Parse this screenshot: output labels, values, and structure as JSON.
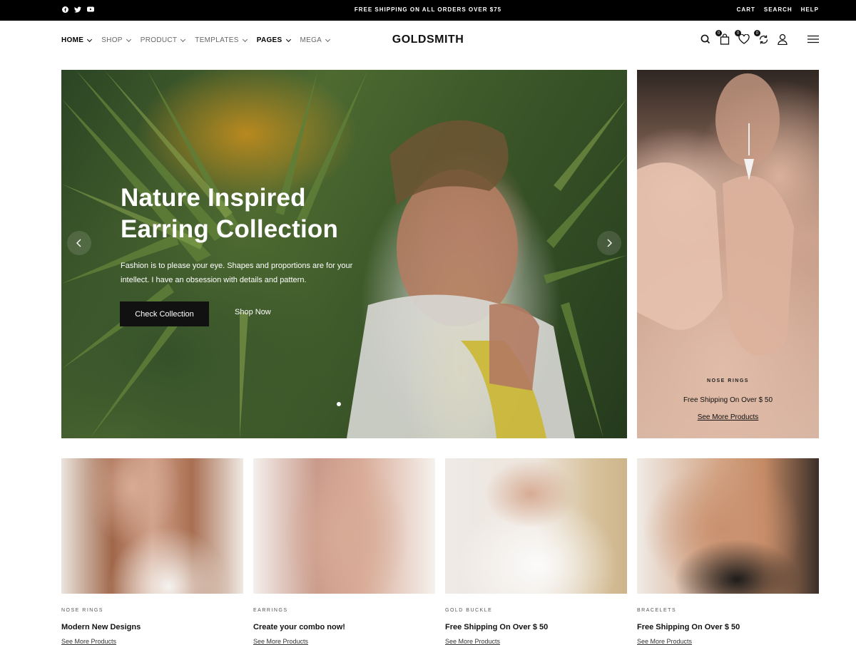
{
  "topbar": {
    "promo": "FREE SHIPPING ON ALL ORDERS OVER $75",
    "links": [
      "CART",
      "SEARCH",
      "HELP"
    ],
    "social_icons": [
      "facebook-icon",
      "twitter-icon",
      "youtube-icon"
    ]
  },
  "header": {
    "logo": "GOLDSMITH",
    "nav": [
      {
        "label": "HOME",
        "active": true
      },
      {
        "label": "SHOP",
        "active": false
      },
      {
        "label": "PRODUCT",
        "active": false
      },
      {
        "label": "TEMPLATES",
        "active": false
      },
      {
        "label": "PAGES",
        "active": true
      },
      {
        "label": "MEGA",
        "active": false
      }
    ],
    "badges": {
      "cart": "0",
      "wishlist": "0",
      "compare": "0"
    },
    "icons": [
      "search-icon",
      "bag-icon",
      "heart-icon",
      "compare-icon",
      "user-icon",
      "menu-icon"
    ]
  },
  "hero": {
    "title_line1": "Nature Inspired",
    "title_line2": "Earring Collection",
    "text": "Fashion is to please your eye. Shapes and proportions are for your intellect. I have an obsession with details and pattern.",
    "primary_button": "Check Collection",
    "secondary_button": "Shop Now"
  },
  "side_banner": {
    "tag": "NOSE RINGS",
    "title": "Free Shipping On Over $ 50",
    "link": "See More Products"
  },
  "cards": [
    {
      "category": "NOSE RINGS",
      "title": "Modern New Designs",
      "link": "See More Products"
    },
    {
      "category": "EARRINGS",
      "title": "Create your combo now!",
      "link": "See More Products"
    },
    {
      "category": "GOLD BUCKLE",
      "title": "Free Shipping On Over $ 50",
      "link": "See More Products"
    },
    {
      "category": "BRACELETS",
      "title": "Free Shipping On Over $ 50",
      "link": "See More Products"
    }
  ],
  "colors": {
    "topbar": "#000000",
    "dark_button": "#111111",
    "text": "#111111"
  }
}
